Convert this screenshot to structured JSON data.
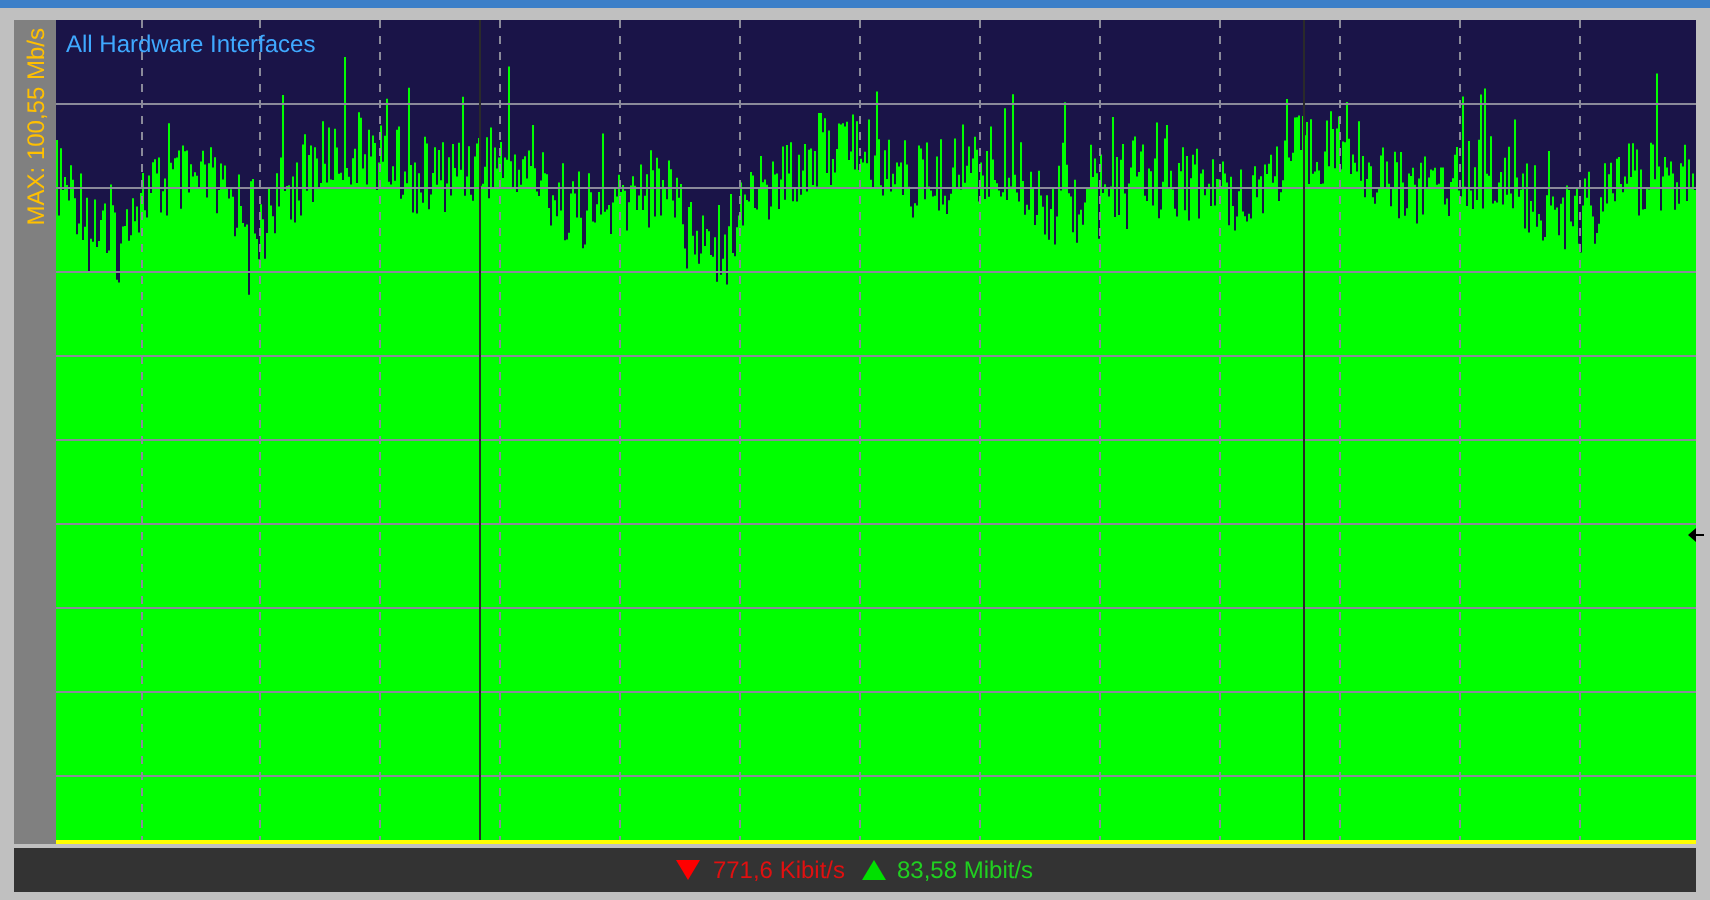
{
  "chart": {
    "title": "All Hardware Interfaces",
    "max_label": "MAX: 100,55 Mb/s"
  },
  "status": {
    "download": "771,6 Kibit/s",
    "upload": "83,58 Mibit/s"
  }
}
